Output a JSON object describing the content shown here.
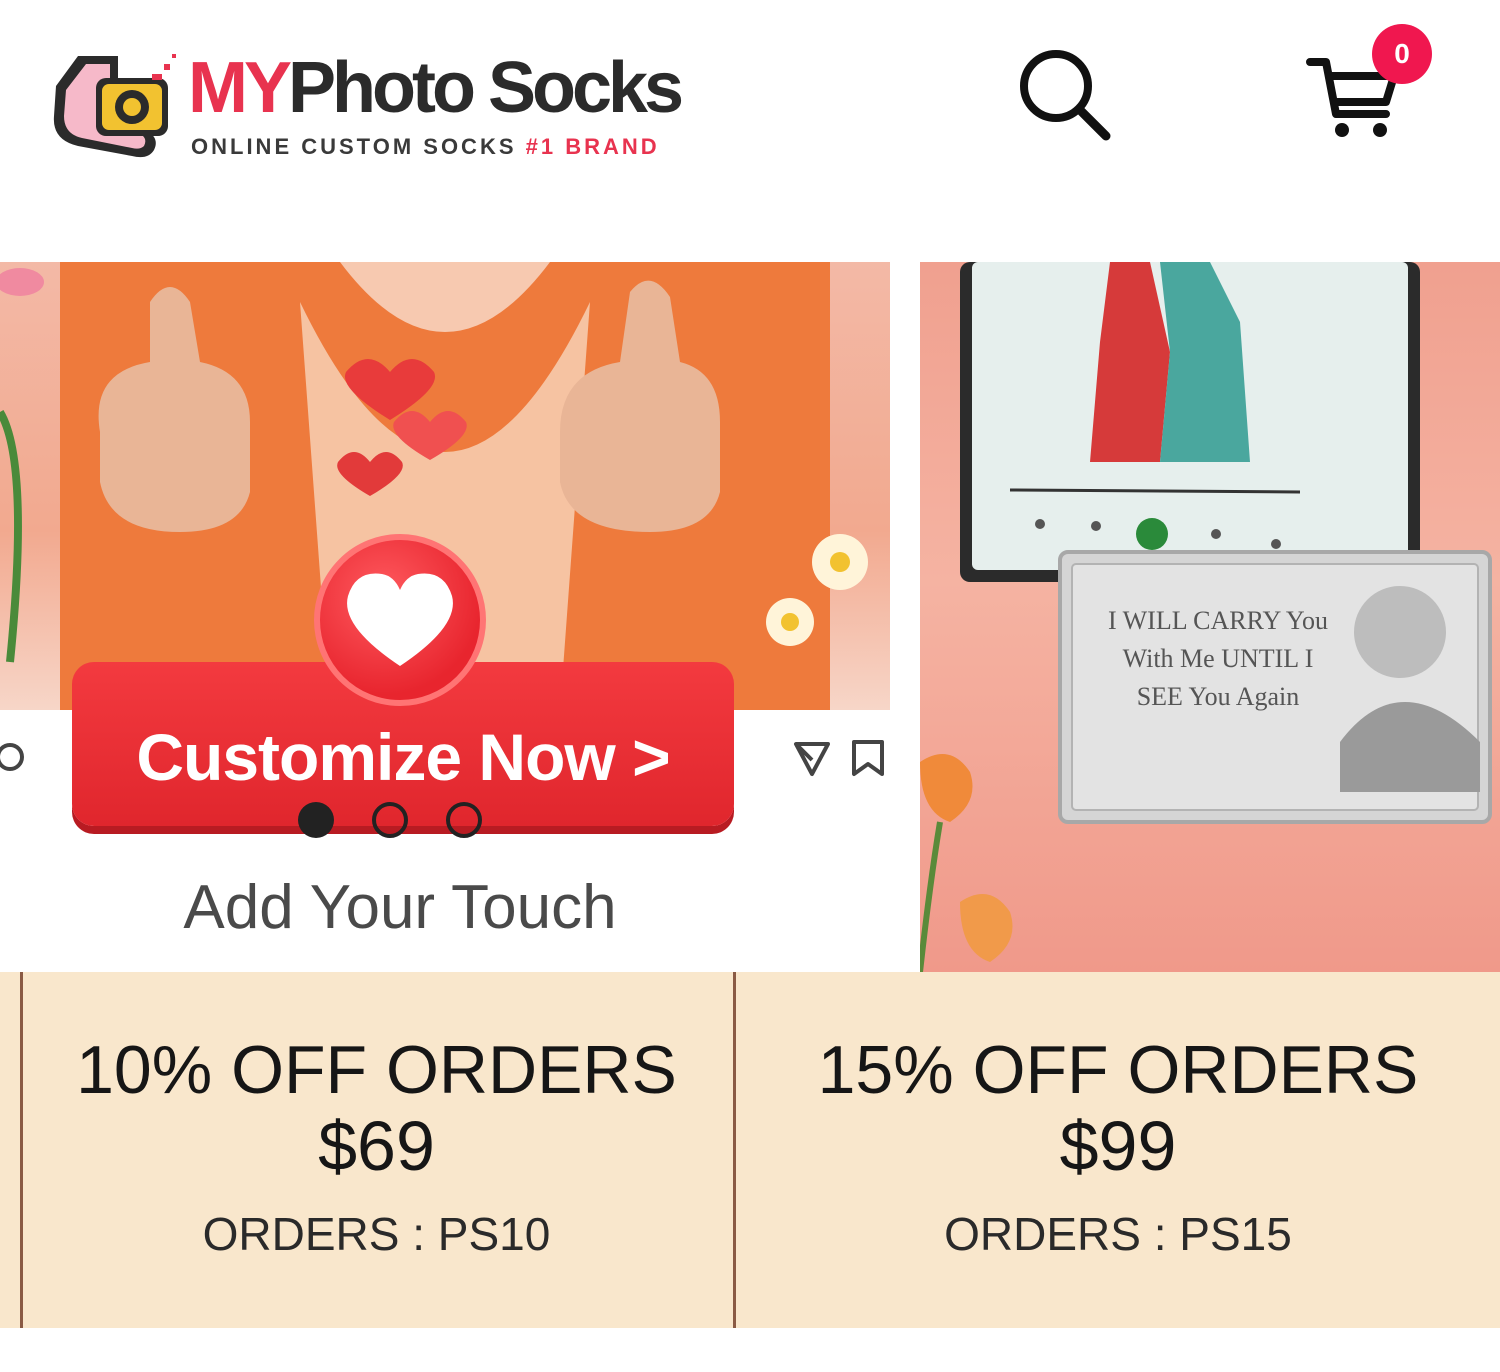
{
  "header": {
    "logo": {
      "brand_my": "MY",
      "brand_rest": "Photo Socks",
      "tagline_main": "ONLINE CUSTOM SOCKS",
      "tagline_highlight": "#1 BRAND"
    },
    "search_icon": "search-icon",
    "cart": {
      "icon": "cart-icon",
      "count": "0"
    }
  },
  "banners": {
    "left": {
      "cta_label": "Customize Now >",
      "subtitle": "Add Your Touch",
      "carousel_active_index": 0,
      "carousel_count": 3
    },
    "right": {
      "plaque_text": "I WILL CARRY You With Me UNTIL I SEE You Again"
    }
  },
  "coupons": [
    {
      "title": "10% OFF ORDERS",
      "amount": "$69",
      "code": "ORDERS : PS10"
    },
    {
      "title": "15% OFF ORDERS",
      "amount": "$99",
      "code": "ORDERS : PS15"
    }
  ],
  "colors": {
    "brand_red": "#e8334f",
    "badge_pink": "#f0174f",
    "cta_red": "#e0262d",
    "coupon_bg": "#f9e7cc",
    "coupon_divider": "#8a5a44"
  }
}
